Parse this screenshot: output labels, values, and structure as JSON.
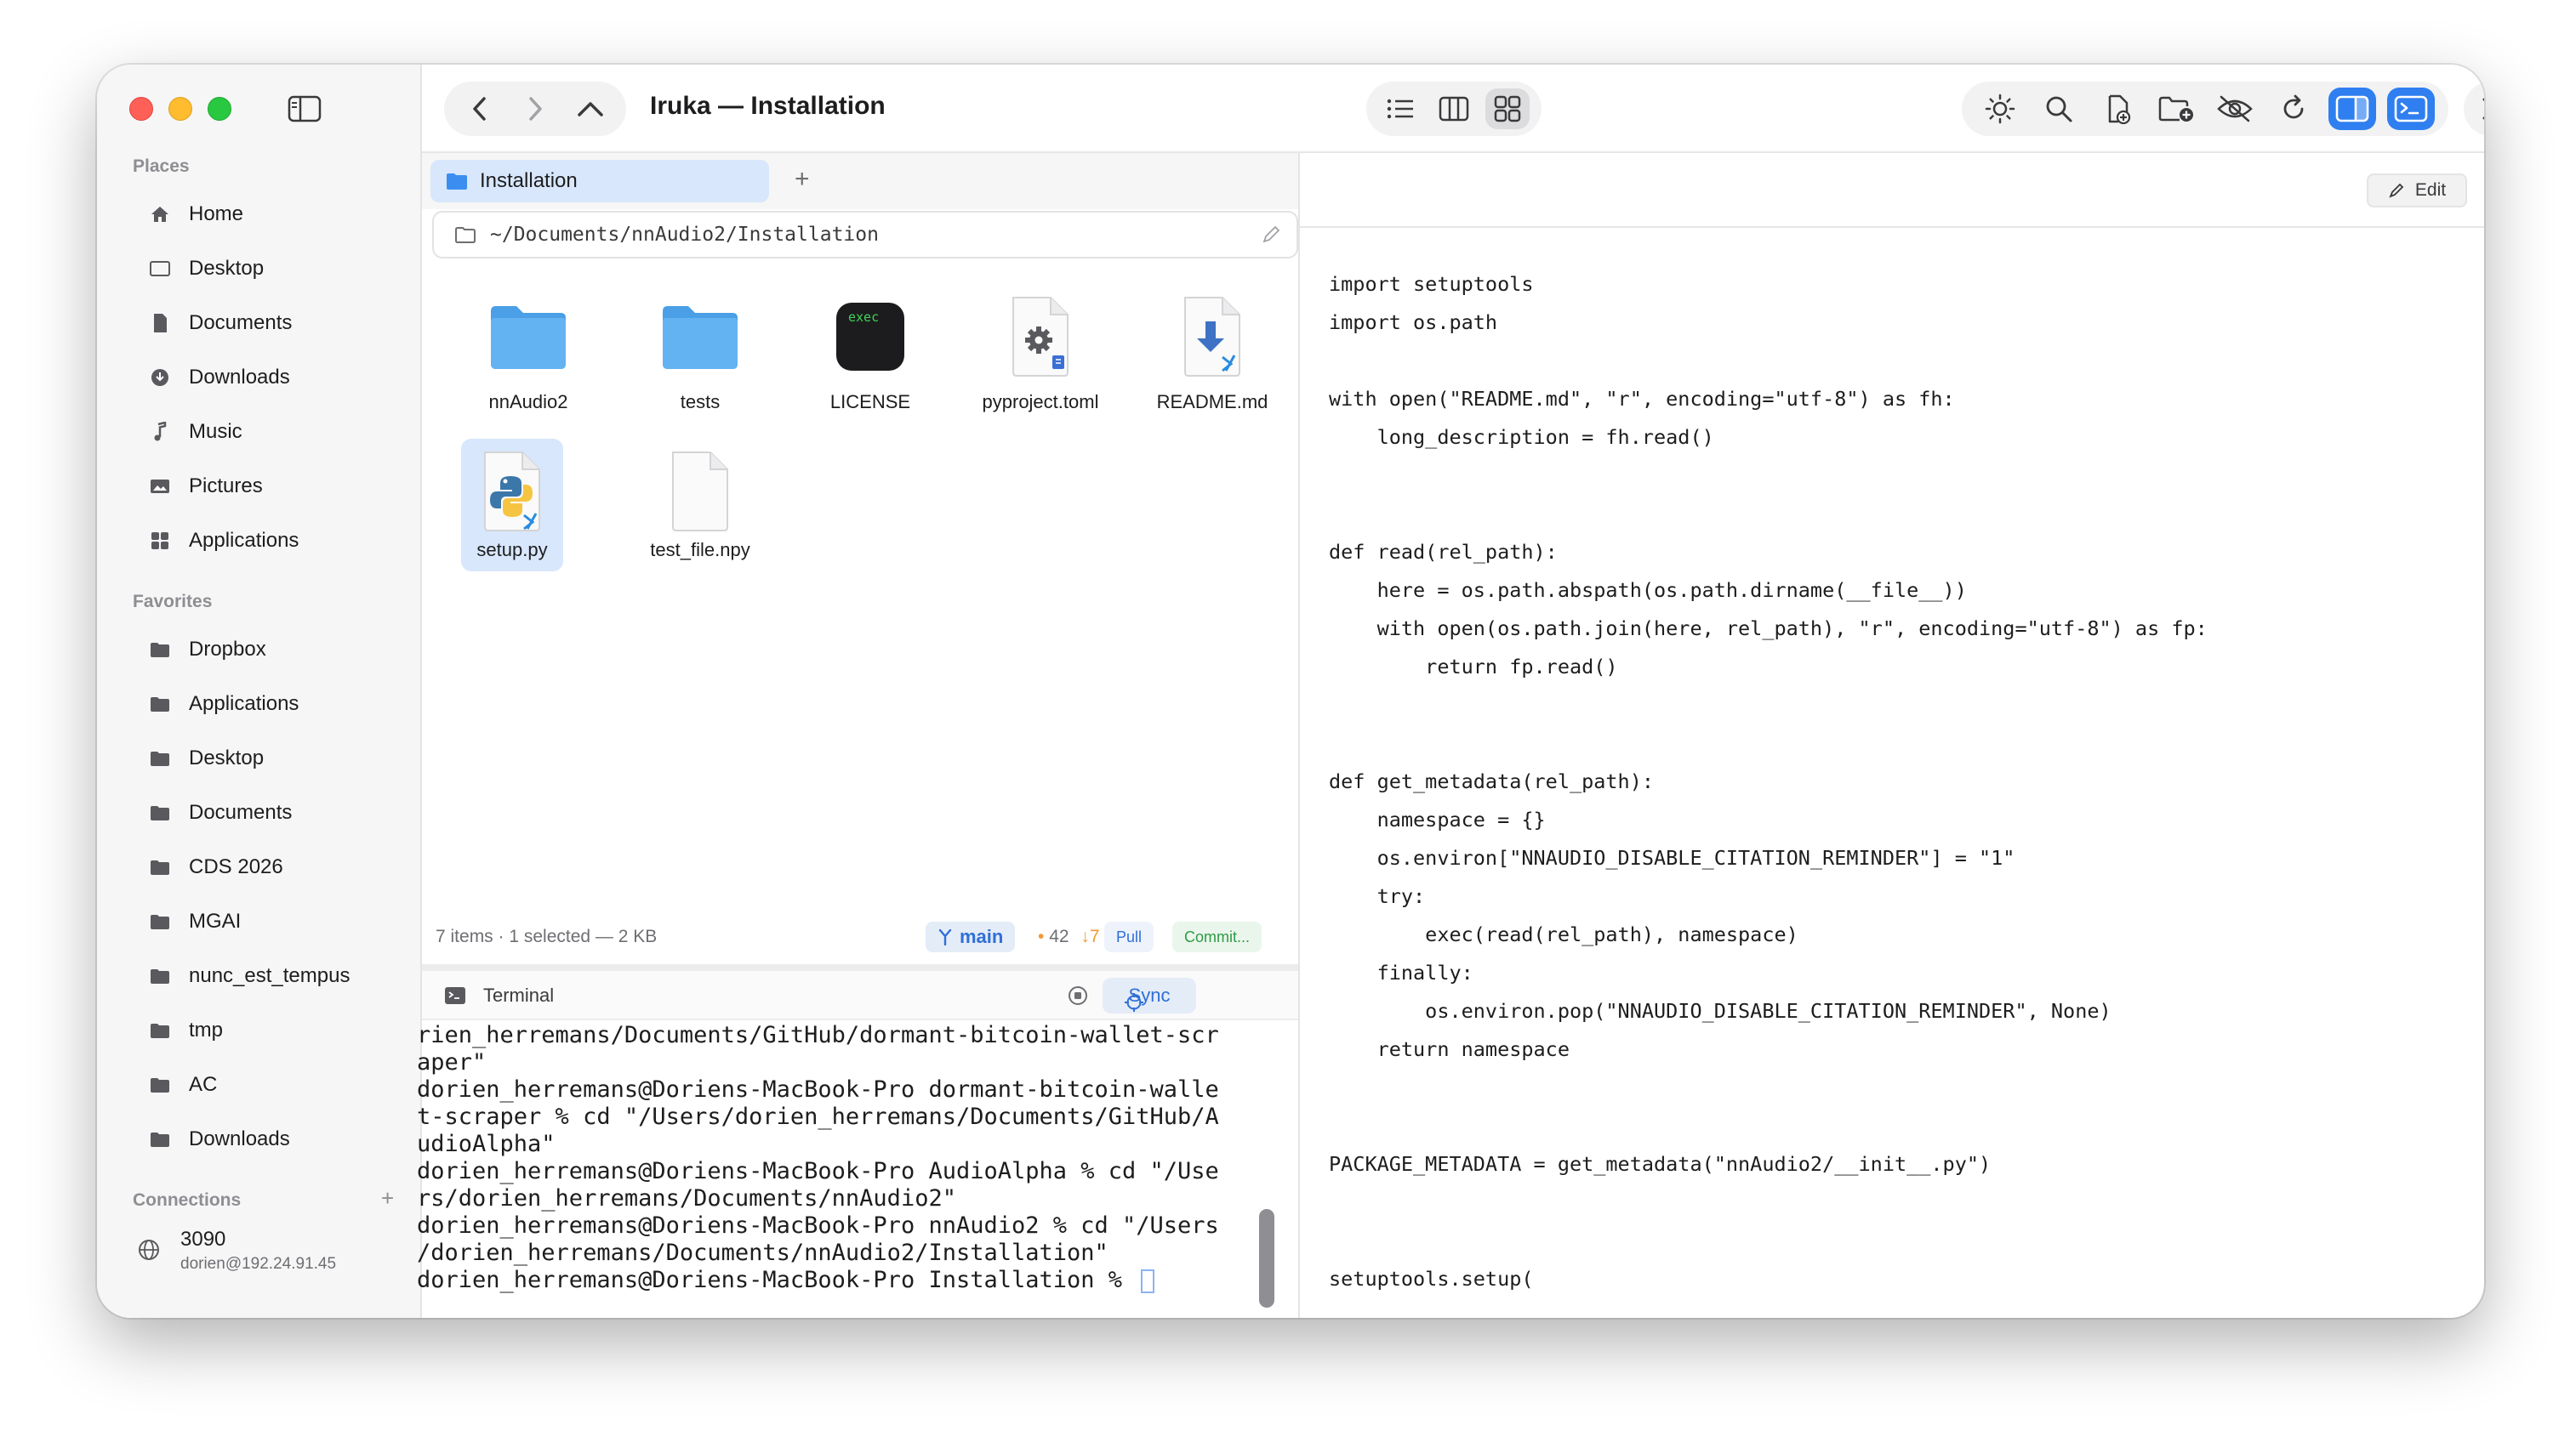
{
  "window": {
    "title": "Iruka — Installation"
  },
  "sidebar": {
    "places_title": "Places",
    "places": [
      {
        "label": "Home",
        "icon": "house-icon"
      },
      {
        "label": "Desktop",
        "icon": "desktop-icon"
      },
      {
        "label": "Documents",
        "icon": "document-icon"
      },
      {
        "label": "Downloads",
        "icon": "download-icon"
      },
      {
        "label": "Music",
        "icon": "music-note-icon"
      },
      {
        "label": "Pictures",
        "icon": "photo-icon"
      },
      {
        "label": "Applications",
        "icon": "grid-icon"
      }
    ],
    "favorites_title": "Favorites",
    "favorites": [
      {
        "label": "Dropbox"
      },
      {
        "label": "Applications"
      },
      {
        "label": "Desktop"
      },
      {
        "label": "Documents"
      },
      {
        "label": "CDS 2026"
      },
      {
        "label": "MGAI"
      },
      {
        "label": "nunc_est_tempus"
      },
      {
        "label": "tmp"
      },
      {
        "label": "AC"
      },
      {
        "label": "Downloads"
      }
    ],
    "connections_title": "Connections",
    "connections_add": "+",
    "connection": {
      "name": "3090",
      "address": "dorien@192.24.91.45"
    }
  },
  "tabs": [
    {
      "label": "Installation"
    }
  ],
  "tab_add": "+",
  "path": "~/Documents/nnAudio2/Installation",
  "files": [
    {
      "name": "nnAudio2",
      "kind": "folder"
    },
    {
      "name": "tests",
      "kind": "folder"
    },
    {
      "name": "LICENSE",
      "kind": "exec",
      "badge": "exec"
    },
    {
      "name": "pyproject.toml",
      "kind": "gear-doc"
    },
    {
      "name": "README.md",
      "kind": "md-doc"
    },
    {
      "name": "setup.py",
      "kind": "python",
      "selected": true
    },
    {
      "name": "test_file.npy",
      "kind": "blank"
    }
  ],
  "status": {
    "summary": "7 items  · 1 selected — 2 KB",
    "branch": "main",
    "changes_dot": "•",
    "changes": "42",
    "behind_arrow": "↓",
    "behind": "7",
    "pull": "Pull",
    "commit": "Commit..."
  },
  "terminal": {
    "title": "Terminal",
    "sync": "Sync",
    "lines": [
      "rien_herremans/Documents/GitHub/dormant-bitcoin-wallet-scr",
      "aper\"",
      "dorien_herremans@Doriens-MacBook-Pro dormant-bitcoin-walle",
      "t-scraper % cd \"/Users/dorien_herremans/Documents/GitHub/A",
      "udioAlpha\"",
      "dorien_herremans@Doriens-MacBook-Pro AudioAlpha % cd \"/Use",
      "rs/dorien_herremans/Documents/nnAudio2\"",
      "dorien_herremans@Doriens-MacBook-Pro nnAudio2 % cd \"/Users",
      "/dorien_herremans/Documents/nnAudio2/Installation\"",
      "dorien_herremans@Doriens-MacBook-Pro Installation % "
    ]
  },
  "editor": {
    "edit_label": "Edit",
    "code_lines": [
      "import setuptools",
      "import os.path",
      "",
      "with open(\"README.md\", \"r\", encoding=\"utf-8\") as fh:",
      "    long_description = fh.read()",
      "",
      "",
      "def read(rel_path):",
      "    here = os.path.abspath(os.path.dirname(__file__))",
      "    with open(os.path.join(here, rel_path), \"r\", encoding=\"utf-8\") as fp:",
      "        return fp.read()",
      "",
      "",
      "def get_metadata(rel_path):",
      "    namespace = {}",
      "    os.environ[\"NNAUDIO_DISABLE_CITATION_REMINDER\"] = \"1\"",
      "    try:",
      "        exec(read(rel_path), namespace)",
      "    finally:",
      "        os.environ.pop(\"NNAUDIO_DISABLE_CITATION_REMINDER\", None)",
      "    return namespace",
      "",
      "",
      "PACKAGE_METADATA = get_metadata(\"nnAudio2/__init__.py\")",
      "",
      "",
      "setuptools.setup("
    ]
  },
  "colors": {
    "accent": "#2f7ff0",
    "selection": "#d8e7fb",
    "folder": "#5aaef0",
    "git_branch": "#2f6fd6",
    "changes": "#f09a37",
    "commit": "#2e9b46"
  }
}
